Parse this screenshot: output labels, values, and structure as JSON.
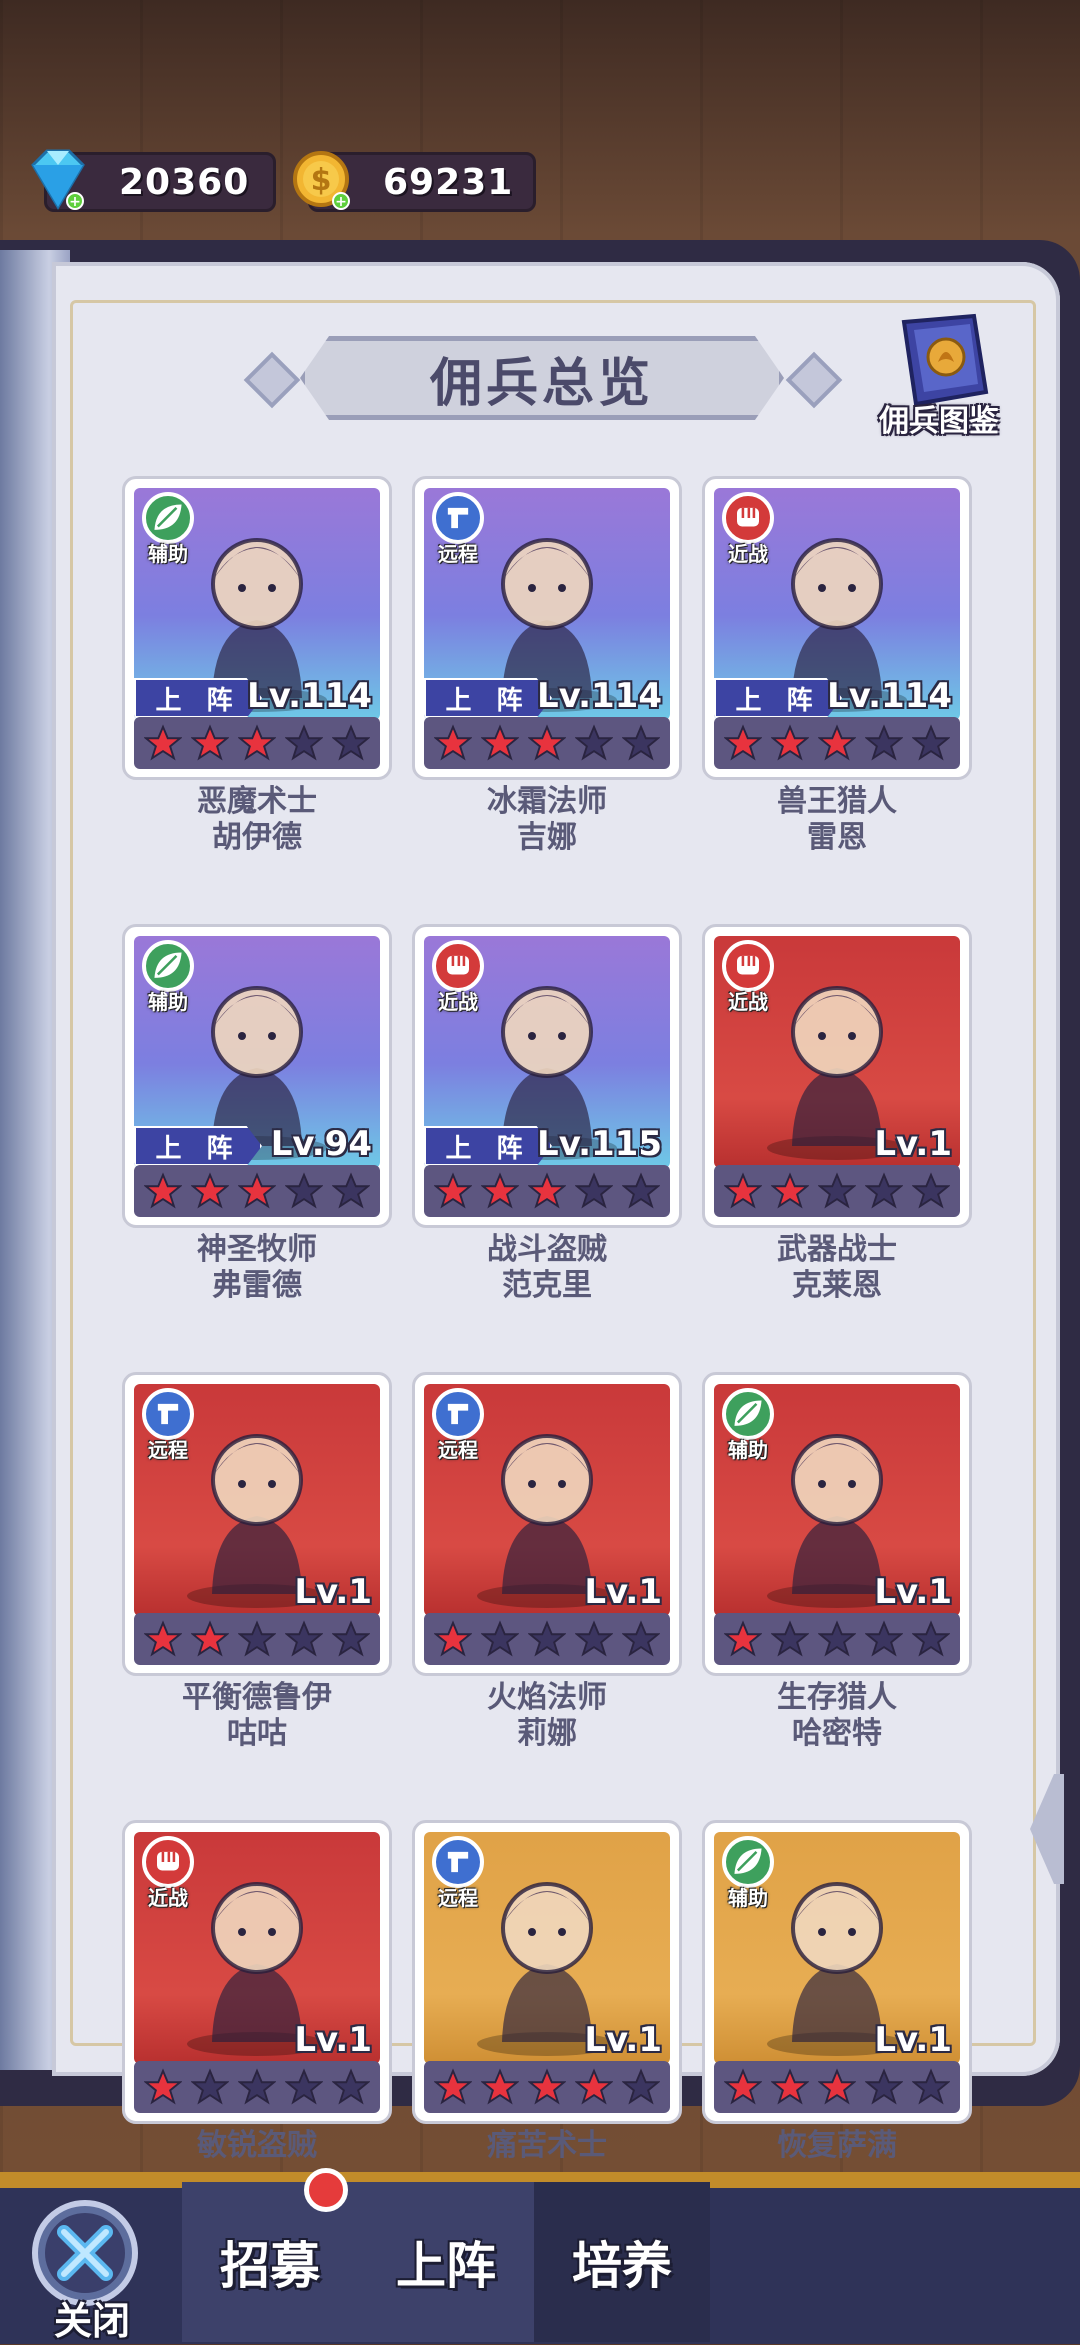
{
  "currency": {
    "gems": "20360",
    "gold": "69231"
  },
  "title": "佣兵总览",
  "codex_label": "佣兵图鉴",
  "deploy_label": "上 阵",
  "heroes": [
    {
      "name1": "恶魔术士",
      "name2": "胡伊德",
      "role": "辅助",
      "role_type": "support",
      "bg": "purple",
      "level": "Lv.114",
      "deployed": true,
      "stars": 3
    },
    {
      "name1": "冰霜法师",
      "name2": "吉娜",
      "role": "远程",
      "role_type": "ranged",
      "bg": "purple",
      "level": "Lv.114",
      "deployed": true,
      "stars": 3
    },
    {
      "name1": "兽王猎人",
      "name2": "雷恩",
      "role": "近战",
      "role_type": "melee",
      "bg": "purple",
      "level": "Lv.114",
      "deployed": true,
      "stars": 3
    },
    {
      "name1": "神圣牧师",
      "name2": "弗雷德",
      "role": "辅助",
      "role_type": "support",
      "bg": "purple",
      "level": "Lv.94",
      "deployed": true,
      "stars": 3
    },
    {
      "name1": "战斗盗贼",
      "name2": "范克里",
      "role": "近战",
      "role_type": "melee",
      "bg": "purple",
      "level": "Lv.115",
      "deployed": true,
      "stars": 3
    },
    {
      "name1": "武器战士",
      "name2": "克莱恩",
      "role": "近战",
      "role_type": "melee",
      "bg": "red",
      "level": "Lv.1",
      "deployed": false,
      "stars": 2
    },
    {
      "name1": "平衡德鲁伊",
      "name2": "咕咕",
      "role": "远程",
      "role_type": "ranged",
      "bg": "red",
      "level": "Lv.1",
      "deployed": false,
      "stars": 2
    },
    {
      "name1": "火焰法师",
      "name2": "莉娜",
      "role": "远程",
      "role_type": "ranged",
      "bg": "red",
      "level": "Lv.1",
      "deployed": false,
      "stars": 1
    },
    {
      "name1": "生存猎人",
      "name2": "哈密特",
      "role": "辅助",
      "role_type": "support",
      "bg": "red",
      "level": "Lv.1",
      "deployed": false,
      "stars": 1
    },
    {
      "name1": "敏锐盗贼",
      "name2": "",
      "role": "近战",
      "role_type": "melee",
      "bg": "red",
      "level": "Lv.1",
      "deployed": false,
      "stars": 1
    },
    {
      "name1": "痛苦术士",
      "name2": "",
      "role": "远程",
      "role_type": "ranged",
      "bg": "gold",
      "level": "Lv.1",
      "deployed": false,
      "stars": 4
    },
    {
      "name1": "恢复萨满",
      "name2": "",
      "role": "辅助",
      "role_type": "support",
      "bg": "gold",
      "level": "Lv.1",
      "deployed": false,
      "stars": 3
    }
  ],
  "bottom_nav": {
    "close": "关闭",
    "recruit": "招募",
    "deploy": "上阵",
    "train": "培养"
  },
  "colors": {
    "star_on": "#e8333e",
    "star_off": "#3b3560",
    "accent": "#3d44a3"
  }
}
